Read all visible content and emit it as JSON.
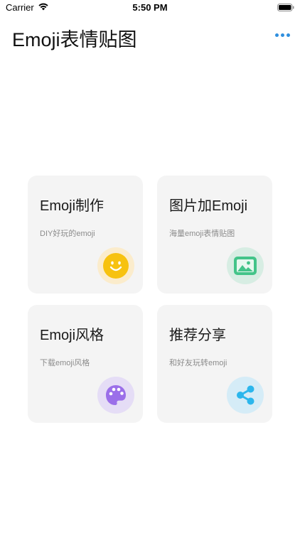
{
  "status_bar": {
    "carrier": "Carrier",
    "time": "5:50 PM"
  },
  "header": {
    "title": "Emoji表情贴图",
    "more_icon": "ellipsis-icon",
    "accent_color": "#2f8fde"
  },
  "cards": [
    {
      "title": "Emoji制作",
      "subtitle": "DIY好玩的emoji",
      "icon": "smiley-face-icon",
      "icon_color": "#f7c20f",
      "icon_bg": "#fbeccc"
    },
    {
      "title": "图片加Emoji",
      "subtitle": "海量emoji表情贴图",
      "icon": "image-icon",
      "icon_color": "#43c489",
      "icon_bg": "#d7ede3"
    },
    {
      "title": "Emoji风格",
      "subtitle": "下载emoji风格",
      "icon": "palette-icon",
      "icon_color": "#9b6fe9",
      "icon_bg": "#e5ddf6"
    },
    {
      "title": "推荐分享",
      "subtitle": "和好友玩转emoji",
      "icon": "share-icon",
      "icon_color": "#2bb6ec",
      "icon_bg": "#d5ecf7"
    }
  ]
}
